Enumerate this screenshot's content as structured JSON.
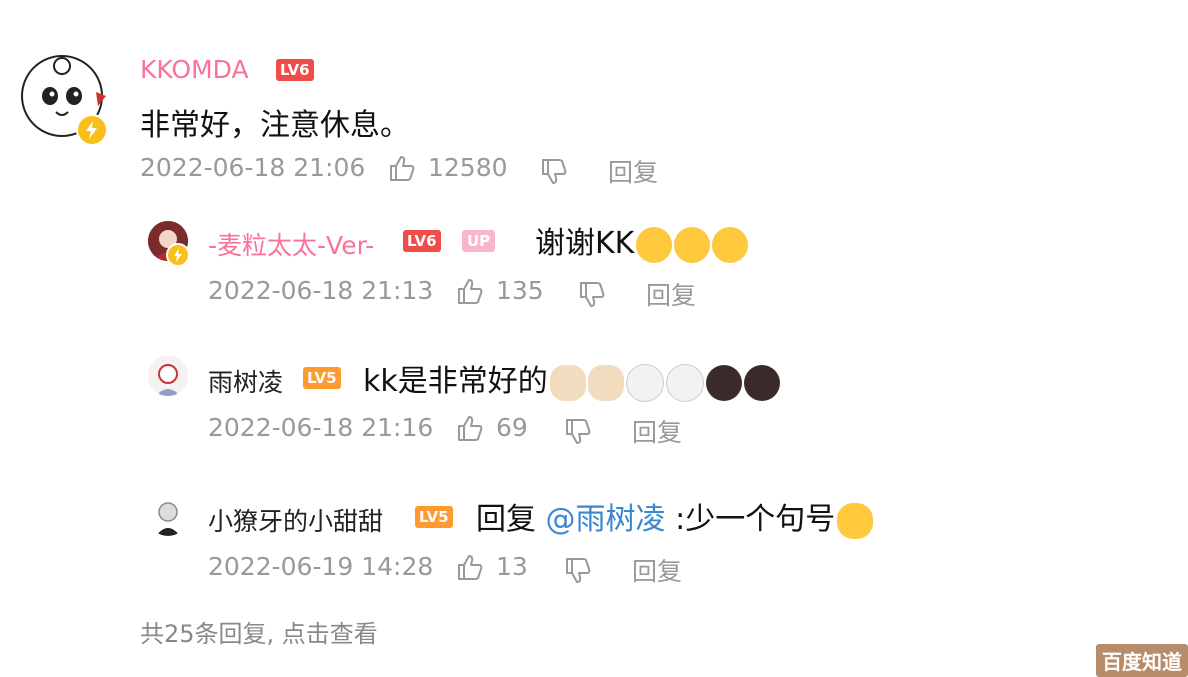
{
  "main_comment": {
    "username": "KKOMDA",
    "level": "LV6",
    "text": "非常好，注意休息。",
    "timestamp": "2022-06-18 21:06",
    "likes": "12580",
    "reply_label": "回复"
  },
  "replies": [
    {
      "username": "-麦粒太太-Ver-",
      "level": "LV6",
      "badge": "UP",
      "text": "谢谢KK",
      "emoji_count": 3,
      "timestamp": "2022-06-18 21:13",
      "likes": "135",
      "reply_label": "回复"
    },
    {
      "username": "雨树凌",
      "level": "LV5",
      "text": "kk是非常好的",
      "emoji_count": 6,
      "timestamp": "2022-06-18 21:16",
      "likes": "69",
      "reply_label": "回复"
    },
    {
      "username": "小獠牙的小甜甜",
      "level": "LV5",
      "reply_prefix": "回复",
      "mention": "@雨树凌",
      "text": ":少一个句号",
      "emoji_count": 1,
      "timestamp": "2022-06-19 14:28",
      "likes": "13",
      "reply_label": "回复"
    }
  ],
  "footer": "共25条回复, 点击查看",
  "watermark": "百度知道",
  "colors": {
    "username_pink": "#fb7299",
    "lv6": "#f04c49",
    "lv5": "#ff9a2e",
    "up_badge": "#f8b6cc",
    "meta_gray": "#999999",
    "mention_blue": "#3b86d1"
  },
  "icons": [
    "thumbs-up-icon",
    "thumbs-down-icon"
  ]
}
